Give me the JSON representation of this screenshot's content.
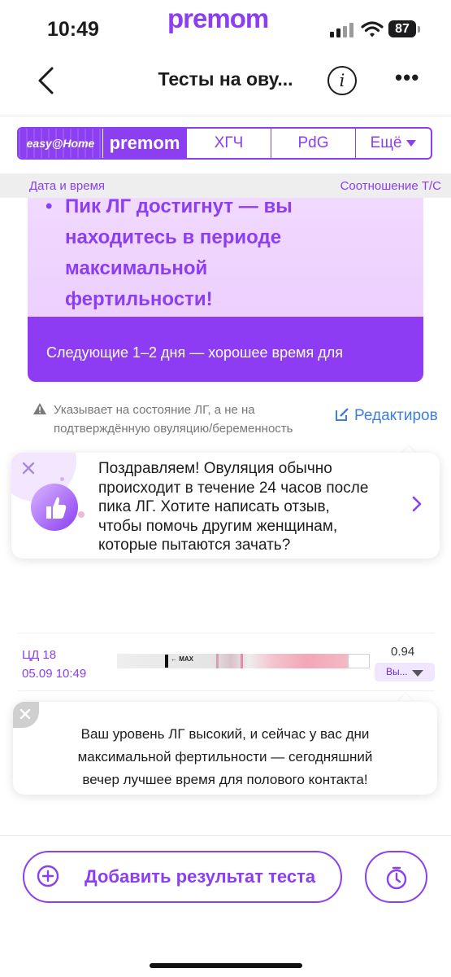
{
  "status_bar": {
    "time": "10:49",
    "brand": "premom",
    "battery": "87"
  },
  "nav": {
    "title": "Тесты на ову...",
    "info_label": "i",
    "more_label": "•••"
  },
  "tabs": {
    "easy_home": "easy@Home",
    "premom": "premom",
    "hcg": "ХГЧ",
    "pdg": "PdG",
    "more": "Ещё"
  },
  "columns": {
    "left": "Дата и время",
    "right": "Соотношение Т/С"
  },
  "peak_card": {
    "bullet": "•",
    "line1": "Пик ЛГ достигнут — вы",
    "line2": "находитесь в периоде",
    "line3": "максимальной",
    "line4": "фертильности!",
    "footer": "Следующие 1–2 дня — хорошее время для"
  },
  "warning": {
    "line1": "Указывает на состояние ЛГ, а не на",
    "line2": "подтверждённую овуляцию/беременность",
    "edit_label": "Редактиров"
  },
  "review_bubble": {
    "line1": "Поздравляем! Овуляция обычно",
    "line2": "происходит в течение 24 часов после",
    "line3": "пика ЛГ. Хотите написать отзыв,",
    "line4": "чтобы помочь другим женщинам,",
    "line5": "которые пытаются зачать?"
  },
  "test_row": {
    "cycle_day": "ЦД 18",
    "datetime": "05.09 10:49",
    "strip_label": "MAX",
    "ratio": "0.94",
    "result": "Вы..."
  },
  "lh_bubble": {
    "line1": "Ваш уровень ЛГ высокий, и сейчас у вас дни",
    "line2": "максимальной фертильности — сегодняшний",
    "line3": "вечер лучшее время для полового контакта!"
  },
  "bottom": {
    "add_label": "Добавить результат теста"
  },
  "colors": {
    "accent": "#8b3ff0",
    "link": "#3d7fd9",
    "card_bg": "#eacafd"
  }
}
